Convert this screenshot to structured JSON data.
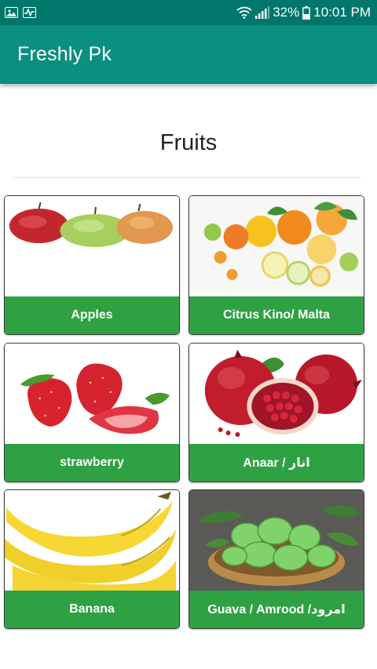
{
  "status_bar": {
    "battery": "32%",
    "time": "10:01 PM",
    "icons": [
      "image-notification-icon",
      "activity-notification-icon",
      "wifi-icon",
      "signal-icon",
      "battery-icon"
    ]
  },
  "app_bar": {
    "title": "Freshly Pk"
  },
  "page": {
    "heading": "Fruits"
  },
  "items": [
    {
      "label": "Apples"
    },
    {
      "label": "Citrus Kino/ Malta"
    },
    {
      "label": "strawberry"
    },
    {
      "label": "Anaar / انار"
    },
    {
      "label": "Banana"
    },
    {
      "label": "Guava / Amrood /امرود"
    }
  ],
  "colors": {
    "status_bar": "#00776a",
    "app_bar": "#0a8f80",
    "label_bar": "#2ea143"
  }
}
